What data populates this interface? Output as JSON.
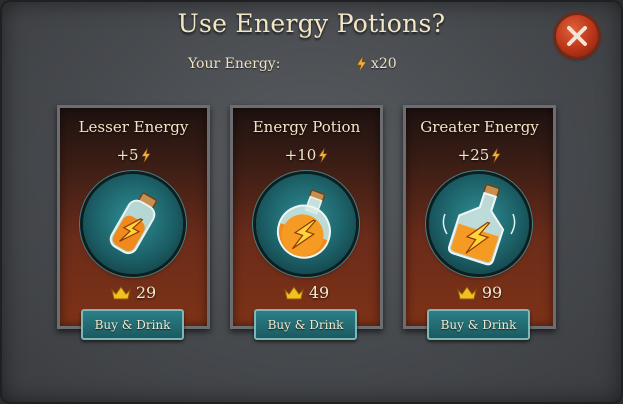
{
  "dialog": {
    "title": "Use Energy Potions?",
    "energy_label": "Your Energy:",
    "energy_value": "x20"
  },
  "potions": [
    {
      "name": "Lesser Energy",
      "gain": "+5",
      "price": "29",
      "buy_label": "Buy & Drink",
      "potion_icon": "small-vial-icon"
    },
    {
      "name": "Energy Potion",
      "gain": "+10",
      "price": "49",
      "buy_label": "Buy & Drink",
      "potion_icon": "round-flask-icon"
    },
    {
      "name": "Greater Energy",
      "gain": "+25",
      "price": "99",
      "buy_label": "Buy & Drink",
      "potion_icon": "large-flask-icon"
    }
  ],
  "colors": {
    "accent_energy": "#f2b23a",
    "button": "#1b5a61",
    "card_background": "#6b2c1a",
    "close_button": "#b93418"
  }
}
